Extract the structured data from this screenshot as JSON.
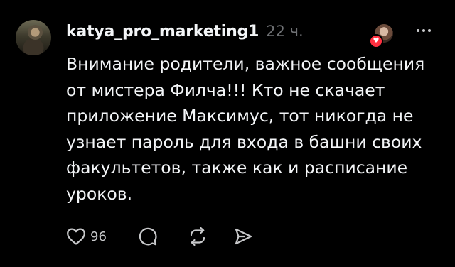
{
  "post": {
    "username": "katya_pro_marketing1",
    "time": "22 ч.",
    "text": "Внимание родители, важное сообщения\nот мистера Филча!!! Кто не скачает\nприложение Максимус, тот никогда не\nузнает пароль для входа в башни своих\nфакультетов, также как и расписание\nуроков.",
    "likes": "96"
  },
  "icons": {
    "avatar": "profile-avatar",
    "reaction": "heart-reaction-avatar",
    "more": "more-icon",
    "like": "heart-icon",
    "comment": "comment-icon",
    "repost": "repost-icon",
    "share": "send-icon"
  },
  "colors": {
    "background": "#000000",
    "text": "#f3f5f7",
    "muted": "#6f7174",
    "icon": "#c8c9cb",
    "heart": "#ff3040"
  }
}
